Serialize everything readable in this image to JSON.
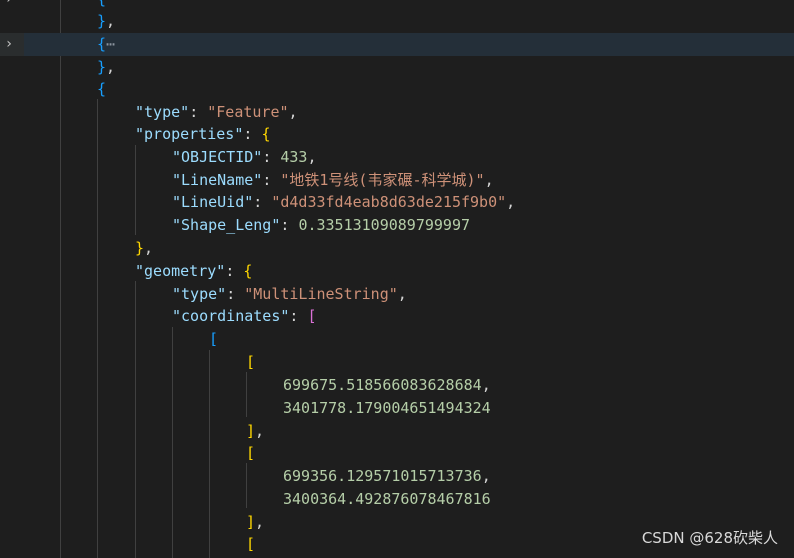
{
  "icons": {
    "fold_closed": "chevron-right-icon"
  },
  "lines": {
    "l0": {
      "brace": "{"
    },
    "l1": {
      "brace": "}",
      "comma": ","
    },
    "l2": {
      "brace": "{",
      "ellipsis": "⋯"
    },
    "l3": {
      "brace": "}",
      "comma": ","
    },
    "l4": {
      "brace": "{"
    },
    "type": {
      "key": "\"type\"",
      "colon": ": ",
      "value": "\"Feature\"",
      "comma": ","
    },
    "properties": {
      "key": "\"properties\"",
      "colon": ": ",
      "brace": "{"
    },
    "objectid": {
      "key": "\"OBJECTID\"",
      "colon": ": ",
      "value": "433",
      "comma": ","
    },
    "linename": {
      "key": "\"LineName\"",
      "colon": ": ",
      "value": "\"地铁1号线(韦家碾-科学城)\"",
      "comma": ","
    },
    "lineuid": {
      "key": "\"LineUid\"",
      "colon": ": ",
      "value": "\"d4d33fd4eab8d63de215f9b0\"",
      "comma": ","
    },
    "shape_leng": {
      "key": "\"Shape_Leng\"",
      "colon": ": ",
      "value": "0.33513109089799997"
    },
    "properties_close": {
      "brace": "}",
      "comma": ","
    },
    "geometry": {
      "key": "\"geometry\"",
      "colon": ": ",
      "brace": "{"
    },
    "geo_type": {
      "key": "\"type\"",
      "colon": ": ",
      "value": "\"MultiLineString\"",
      "comma": ","
    },
    "coordinates": {
      "key": "\"coordinates\"",
      "colon": ": ",
      "bracket": "["
    },
    "outer_open": {
      "bracket": "["
    },
    "pt1_open": {
      "bracket": "["
    },
    "pt1_x": {
      "value": "699675.518566083628684",
      "comma": ","
    },
    "pt1_y": {
      "value": "3401778.179004651494324"
    },
    "pt1_close": {
      "bracket": "]",
      "comma": ","
    },
    "pt2_open": {
      "bracket": "["
    },
    "pt2_x": {
      "value": "699356.129571015713736",
      "comma": ","
    },
    "pt2_y": {
      "value": "3400364.492876078467816"
    },
    "pt2_close": {
      "bracket": "]",
      "comma": ","
    },
    "pt3_open": {
      "bracket": "["
    }
  },
  "watermark": {
    "text": "CSDN @628砍柴人"
  },
  "colors": {
    "background": "#1e1e1e",
    "json_key": "#9cdcfe",
    "json_string": "#ce9178",
    "json_number": "#b5cea8",
    "bracket_level_1": "#ffd700",
    "bracket_level_2": "#da70d6",
    "bracket_level_3": "#179fff"
  }
}
